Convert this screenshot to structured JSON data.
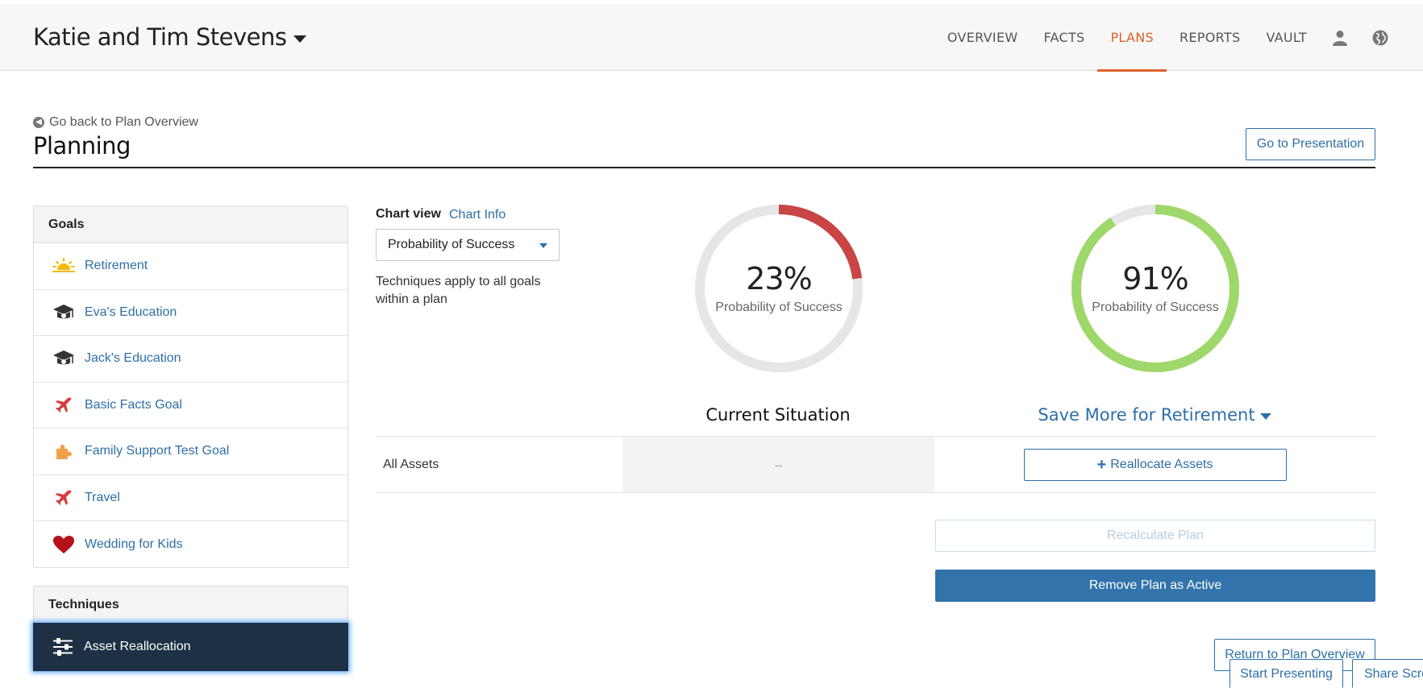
{
  "header": {
    "client_name": "Katie and Tim Stevens",
    "nav": [
      "OVERVIEW",
      "FACTS",
      "PLANS",
      "REPORTS",
      "VAULT"
    ],
    "active_nav": "PLANS",
    "icons": [
      "user-icon",
      "globe-icon"
    ]
  },
  "page": {
    "back_link": "Go back to Plan Overview",
    "title": "Planning",
    "go_presentation": "Go to Presentation"
  },
  "goals": {
    "header": "Goals",
    "items": [
      {
        "label": "Retirement",
        "icon": "sunset-icon"
      },
      {
        "label": "Eva's Education",
        "icon": "graduation-cap-icon"
      },
      {
        "label": "Jack's Education",
        "icon": "graduation-cap-icon"
      },
      {
        "label": "Basic Facts Goal",
        "icon": "airplane-icon"
      },
      {
        "label": "Family Support Test Goal",
        "icon": "puzzle-icon"
      },
      {
        "label": "Travel",
        "icon": "airplane-icon"
      },
      {
        "label": "Wedding for Kids",
        "icon": "heart-icon"
      }
    ]
  },
  "techniques": {
    "header": "Techniques",
    "items": [
      {
        "label": "Asset Reallocation",
        "icon": "sliders-icon"
      }
    ]
  },
  "chart": {
    "view_label": "Chart view",
    "info_link": "Chart Info",
    "selected_view": "Probability of Success",
    "note": "Techniques apply to all goals within a plan"
  },
  "current": {
    "percent_label": "23%",
    "value": 23,
    "sub_label": "Probability of Success",
    "heading": "Current Situation",
    "color": "#c94545"
  },
  "alternative": {
    "percent_label": "91%",
    "value": 91,
    "sub_label": "Probability of Success",
    "heading": "Save More for Retirement",
    "color": "#9ed86a"
  },
  "table": {
    "row_label": "All Assets",
    "current_value": "--",
    "realloc_button": "Reallocate Assets"
  },
  "actions": {
    "recalculate": "Recalculate Plan",
    "remove_active": "Remove Plan as Active",
    "return_overview": "Return to Plan Overview",
    "start_presenting": "Start Presenting",
    "share_screen": "Share Screen"
  },
  "colors": {
    "accent": "#e0612a",
    "link": "#2d6fa8",
    "primary_button": "#3273ab",
    "technique_bg": "#1e3144",
    "donut_track": "#e6e6e6"
  }
}
